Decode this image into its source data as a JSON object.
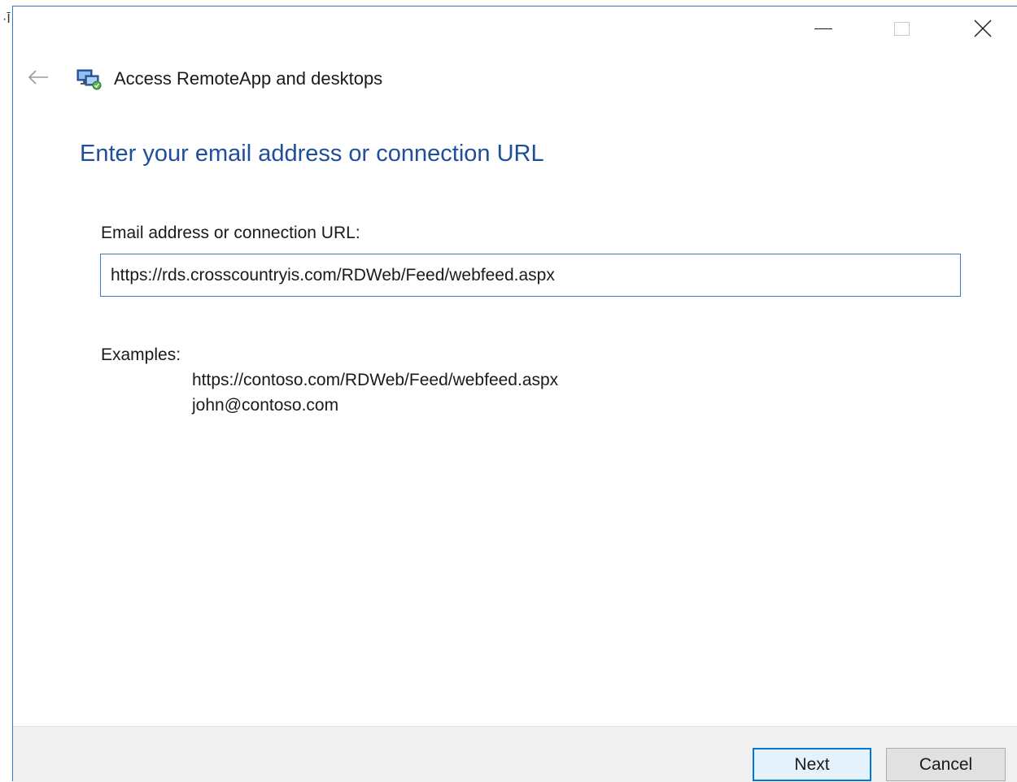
{
  "window": {
    "title": "Access RemoteApp and desktops",
    "accent_color": "#0078d7",
    "heading_color": "#1f4e9c"
  },
  "caption_buttons": {
    "minimize_icon": "minimize-icon",
    "maximize_icon": "maximize-icon",
    "close_icon": "close-icon"
  },
  "nav": {
    "back_icon": "back-arrow-icon",
    "app_icon": "remote-desktop-icon"
  },
  "page": {
    "heading": "Enter your email address or connection URL",
    "field_label": "Email address or connection URL:",
    "field_value": "https://rds.crosscountryis.com/RDWeb/Feed/webfeed.aspx",
    "examples_label": "Examples:",
    "examples": [
      "https://contoso.com/RDWeb/Feed/webfeed.aspx",
      "john@contoso.com"
    ]
  },
  "footer": {
    "next_label": "Next",
    "cancel_label": "Cancel"
  }
}
